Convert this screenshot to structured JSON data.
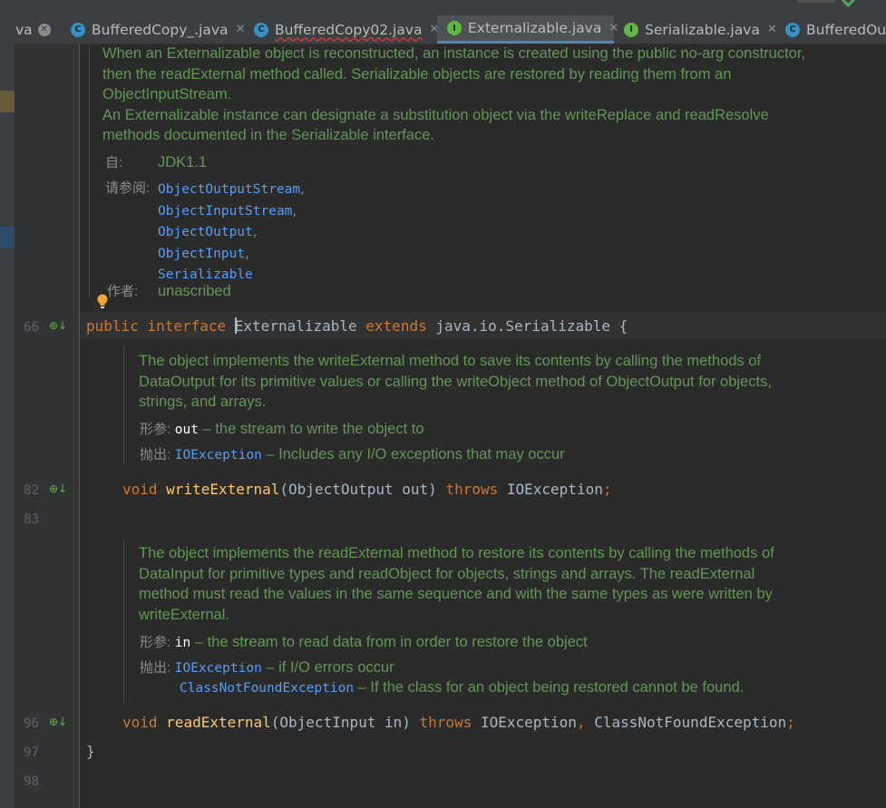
{
  "tabs": [
    {
      "label": "va",
      "icon": "none",
      "close": "circle"
    },
    {
      "label": "BufferedCopy_.java",
      "icon": "class-icon",
      "close": "x"
    },
    {
      "label": "BufferedCopy02.java",
      "icon": "class-icon",
      "close": "x",
      "error": true
    },
    {
      "label": "Externalizable.java",
      "icon": "interface-icon",
      "close": "x",
      "active": true
    },
    {
      "label": "Serializable.java",
      "icon": "interface-icon",
      "close": "x"
    },
    {
      "label": "BufferedOut",
      "icon": "class-icon",
      "close": "none"
    }
  ],
  "icon_letters": {
    "class": "C",
    "interface": "I"
  },
  "class_doc": {
    "lines": [
      "When an Externalizable object is reconstructed, an instance is created using the public no-arg constructor,",
      "then the readExternal method called. Serializable objects are restored by reading them from an",
      "ObjectInputStream.",
      "An Externalizable instance can designate a substitution object via the writeReplace and readResolve",
      "methods documented in the Serializable interface."
    ],
    "since_label": "自:",
    "since_value": "JDK1.1",
    "see_label": "请参阅:",
    "see_links": [
      "ObjectOutputStream",
      "ObjectInputStream",
      "ObjectOutput",
      "ObjectInput",
      "Serializable"
    ],
    "author_label": "作者:",
    "author_value": "unascribed"
  },
  "code": {
    "decl": {
      "kw1": "public",
      "kw2": "interface",
      "name": "Externalizable",
      "kw3": "extends",
      "rest": "java.io.Serializable {"
    },
    "write": {
      "kw": "void",
      "fn": "writeExternal",
      "params": "(ObjectOutput out)",
      "throws": "throws",
      "exc": "IOException",
      "end": ";"
    },
    "read": {
      "kw": "void",
      "fn": "readExternal",
      "params": "(ObjectInput in)",
      "throws": "throws",
      "exc1": "IOException",
      "comma": ",",
      "exc2": "ClassNotFoundException",
      "end": ";"
    },
    "close": "}"
  },
  "write_doc": {
    "lines": [
      "The object implements the writeExternal method to save its contents by calling the methods of",
      "DataOutput for its primitive values or calling the writeObject method of ObjectOutput for objects,",
      "strings, and arrays."
    ],
    "param_label": "形参:",
    "param_name": "out",
    "param_desc": " – the stream to write the object to",
    "throws_label": "抛出:",
    "throws_exc": "IOException",
    "throws_desc": " – Includes any I/O exceptions that may occur"
  },
  "read_doc": {
    "lines": [
      "The object implements the readExternal method to restore its contents by calling the methods of",
      "DataInput for primitive types and readObject for objects, strings and arrays. The readExternal",
      "method must read the values in the same sequence and with the same types as were written by",
      "writeExternal."
    ],
    "param_label": "形参:",
    "param_name": "in",
    "param_desc": " – the stream to read data from in order to restore the object",
    "throws_label": "抛出:",
    "throws_exc1": "IOException",
    "throws_desc1": " – if I/O errors occur",
    "throws_exc2": "ClassNotFoundException",
    "throws_desc2": " – If the class for an object being restored cannot be found."
  },
  "line_numbers": {
    "decl": "66",
    "write": "82",
    "blank1": "83",
    "read": "96",
    "close": "97",
    "blank2": "98"
  },
  "gutter_icon": "implemented-method-icon",
  "colors": {
    "keyword": "#cc7832",
    "method": "#ffc66d",
    "doc": "#629755",
    "link": "#589df6",
    "text": "#a9b7c6"
  }
}
